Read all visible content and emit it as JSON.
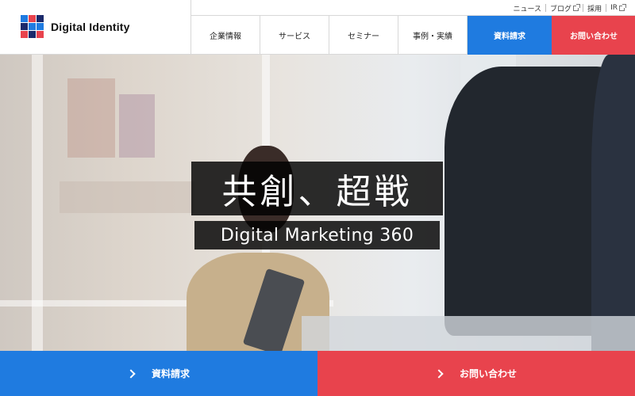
{
  "brand": {
    "name": "Digital Identity",
    "colors": {
      "blue": "#1f7be0",
      "red": "#e8434d",
      "navy": "#1b2a6b"
    }
  },
  "utility_nav": [
    {
      "label": "ニュース",
      "external": false
    },
    {
      "label": "ブログ",
      "external": true,
      "icon": "external-link-icon"
    },
    {
      "label": "採用",
      "external": false
    },
    {
      "label": "IR",
      "external": true,
      "icon": "external-link-icon"
    }
  ],
  "main_nav": [
    {
      "label": "企業情報"
    },
    {
      "label": "サービス"
    },
    {
      "label": "セミナー"
    },
    {
      "label": "事例・実績"
    }
  ],
  "nav_cta": {
    "request": "資料請求",
    "contact": "お問い合わせ"
  },
  "hero": {
    "headline": "共創、超戦",
    "subheadline": "Digital Marketing 360"
  },
  "bottom_cta": {
    "request": "資料請求",
    "contact": "お問い合わせ",
    "icon": "chevron-right-icon"
  }
}
